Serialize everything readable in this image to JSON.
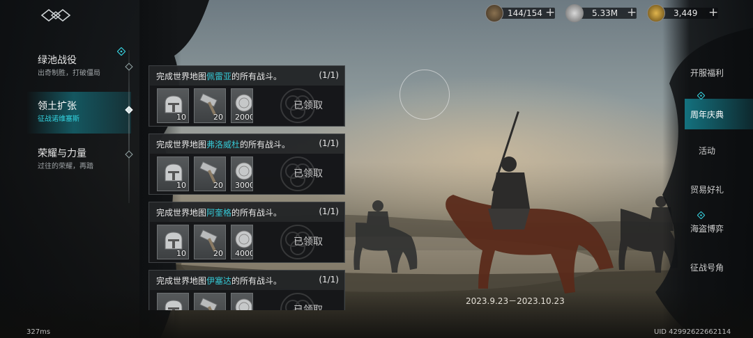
{
  "header": {
    "currencies": [
      {
        "icon": "stamina-icon",
        "value": "144/154",
        "plus": "+"
      },
      {
        "icon": "silver-coin-icon",
        "value": "5.33M",
        "plus": "+"
      },
      {
        "icon": "gold-badge-icon",
        "value": "3,449",
        "plus": "+"
      }
    ]
  },
  "left_nav": {
    "items": [
      {
        "title": "绿池战役",
        "subtitle": "出奇制胜，打破僵局",
        "active": false
      },
      {
        "title": "领土扩张",
        "subtitle": "征战诺维塞斯",
        "active": true
      },
      {
        "title": "荣耀与力量",
        "subtitle": "过往的荣耀，再踏",
        "active": false
      }
    ]
  },
  "tasks": [
    {
      "prefix": "完成世界地图",
      "place": "佩雷亚",
      "suffix": "的所有战斗。",
      "progress": "(1/1)",
      "rewards": [
        {
          "icon": "helmet-icon",
          "count": "10"
        },
        {
          "icon": "hammer-icon",
          "count": "20"
        },
        {
          "icon": "silver-coin-icon",
          "count": "2000"
        }
      ],
      "status": "已领取"
    },
    {
      "prefix": "完成世界地图",
      "place": "弗洛威杜",
      "suffix": "的所有战斗。",
      "progress": "(1/1)",
      "rewards": [
        {
          "icon": "helmet-icon",
          "count": "10"
        },
        {
          "icon": "hammer-icon",
          "count": "20"
        },
        {
          "icon": "silver-coin-icon",
          "count": "3000"
        }
      ],
      "status": "已领取"
    },
    {
      "prefix": "完成世界地图",
      "place": "阿奎格",
      "suffix": "的所有战斗。",
      "progress": "(1/1)",
      "rewards": [
        {
          "icon": "helmet-icon",
          "count": "10"
        },
        {
          "icon": "hammer-icon",
          "count": "20"
        },
        {
          "icon": "silver-coin-icon",
          "count": "4000"
        }
      ],
      "status": "已领取"
    },
    {
      "prefix": "完成世界地图",
      "place": "伊塞达",
      "suffix": "的所有战斗。",
      "progress": "(1/1)",
      "rewards": [
        {
          "icon": "helmet-icon",
          "count": ""
        },
        {
          "icon": "hammer-icon",
          "count": ""
        },
        {
          "icon": "silver-coin-icon",
          "count": ""
        }
      ],
      "status": "已领取"
    }
  ],
  "event": {
    "date_range": "2023.9.23－2023.10.23"
  },
  "right_nav": {
    "items": [
      {
        "label": "开服福利",
        "active": false,
        "dot": false
      },
      {
        "label": "周年庆典",
        "active": true,
        "dot": true
      },
      {
        "label": "活动",
        "active": false,
        "dot": false
      },
      {
        "label": "贸易好礼",
        "active": false,
        "dot": false
      },
      {
        "label": "海盗博弈",
        "active": false,
        "dot": true
      },
      {
        "label": "征战号角",
        "active": false,
        "dot": false
      }
    ]
  },
  "footer": {
    "latency": "327ms",
    "uid": "UID 42992622662114"
  },
  "colors": {
    "accent": "#35c9d6",
    "active_tab": "#168c9b"
  }
}
